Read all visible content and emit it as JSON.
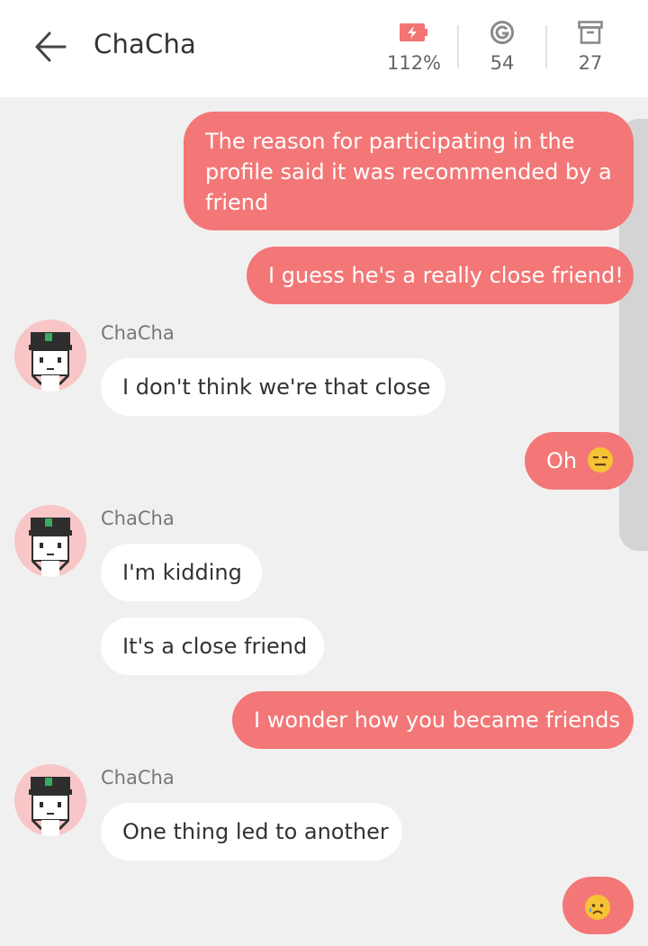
{
  "header": {
    "title": "ChaCha",
    "stats": [
      {
        "icon": "battery-charging-icon",
        "value": "112%"
      },
      {
        "icon": "g-coin-icon",
        "value": "54"
      },
      {
        "icon": "archive-box-icon",
        "value": "27"
      }
    ]
  },
  "colors": {
    "accent": "#f47474",
    "background": "#f0f0f0",
    "avatar_bg": "#f8c6c6"
  },
  "messages": [
    {
      "from": "me",
      "text": "The reason for participating in the profile said it was recommended by a friend"
    },
    {
      "from": "me",
      "text": "I guess he's a really close friend!"
    },
    {
      "from": "them",
      "sender": "ChaCha",
      "text": "I don't think we're that close"
    },
    {
      "from": "me",
      "text": "Oh",
      "emoji": "expressionless-face"
    },
    {
      "from": "them",
      "sender": "ChaCha",
      "text": "I'm kidding"
    },
    {
      "from": "them",
      "text": "It's a close friend"
    },
    {
      "from": "me",
      "text": "I wonder how you became friends"
    },
    {
      "from": "them",
      "sender": "ChaCha",
      "text": "One thing led to another"
    },
    {
      "from": "me",
      "text": "",
      "emoji": "sad-sweat-face"
    }
  ]
}
